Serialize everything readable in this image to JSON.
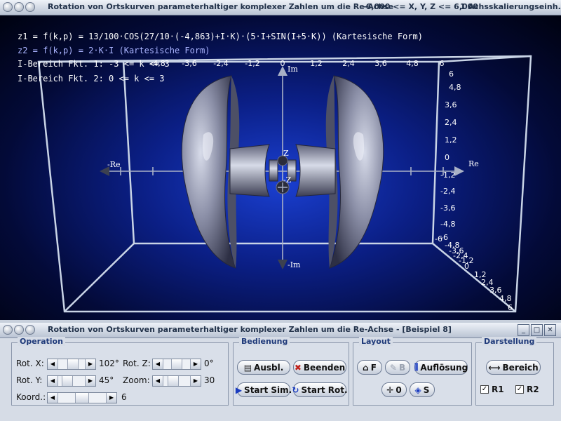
{
  "window": {
    "title": "Rotation von Ortskurven parameterhaltiger komplexer Zahlen um die Re-Achse",
    "range_info": "-6,000 <= X, Y, Z <= 6,000",
    "scale_info": "1 Achsskalierungseinh..."
  },
  "view": {
    "functions": [
      "z1 = f(k,p) = 13/100·COS(27/10·(-4,863)+I·K)·(5·I+SIN(I+5·K)) (Kartesische Form)",
      "z2 = f(k,p) = 2·K·I (Kartesische Form)",
      "I-Bereich Fkt. 1: -3 <= k <= 3",
      "I-Bereich Fkt. 2: 0 <= k <= 3"
    ],
    "axis_labels": {
      "re_pos": "Re",
      "re_neg": "-Re",
      "im_pos": "Im",
      "im_neg": "-Im",
      "z_pos": "Z",
      "z_neg": "-Z"
    },
    "top_ticks": [
      "-4,8",
      "-3,6",
      "-2,4",
      "-1,2",
      "0",
      "1,2",
      "2,4",
      "3,6",
      "4,8",
      "6"
    ],
    "right_ticks": [
      "6",
      "4,8",
      "3,6",
      "2,4",
      "1,2",
      "0",
      "-1,2",
      "-2,4",
      "-3,6",
      "-4,8",
      "-6"
    ],
    "depth_ticks": [
      "-6",
      "-4,8",
      "-3,6",
      "-2,4",
      "-1,2",
      "0",
      "1,2",
      "2,4",
      "3,6",
      "4,8",
      "6"
    ],
    "bottom_ticks": [
      "-1,2",
      "-2,4",
      "-3,6",
      "-4,8",
      "-6"
    ]
  },
  "panel_window": {
    "title": "Rotation von Ortskurven parameterhaltiger komplexer Zahlen um die Re-Achse - [Beispiel 8]"
  },
  "operation": {
    "label": "Operation",
    "rot_x_label": "Rot. X:",
    "rot_x_value": "102°",
    "rot_y_label": "Rot. Y:",
    "rot_y_value": "45°",
    "rot_z_label": "Rot. Z:",
    "rot_z_value": "0°",
    "zoom_label": "Zoom:",
    "zoom_value": "30",
    "koord_label": "Koord.:",
    "koord_value": "6",
    "rot_x_level": 0.57,
    "rot_y_level": 0.25,
    "rot_z_level": 0.5,
    "zoom_level": 0.3,
    "koord_level": 0.5
  },
  "bedienung": {
    "label": "Bedienung",
    "ausbl": "Ausbl.",
    "beenden": "Beenden",
    "start_sim": "Start Sim.",
    "start_rot": "Start Rot."
  },
  "layout": {
    "label": "Layout",
    "f": "F",
    "b": "B",
    "aufloesung": "Auflösung",
    "o": "0",
    "s": "S"
  },
  "darstellung": {
    "label": "Darstellung",
    "bereich": "Bereich",
    "r1": "R1",
    "r2": "R2"
  },
  "colors": {
    "background_center": "#1a3fd1",
    "background_edge": "#000210",
    "frame": "#c9d4e6",
    "formula_text": "#ffffff",
    "formula_text_2": "#aab4ff",
    "group_label": "#1f3a7a"
  }
}
